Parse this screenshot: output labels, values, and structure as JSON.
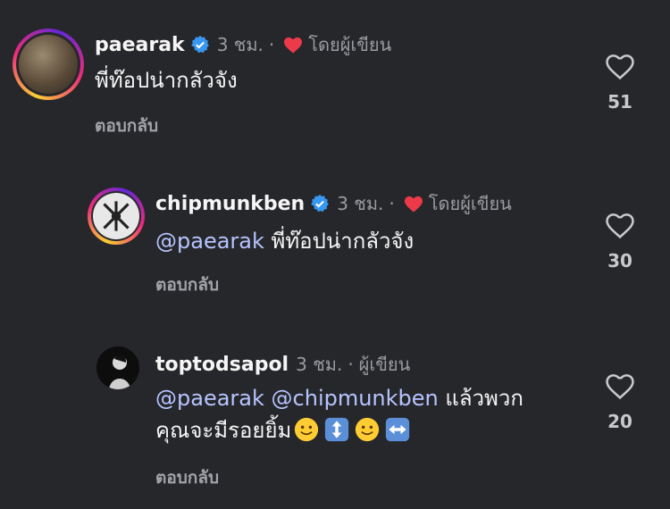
{
  "comments": [
    {
      "username": "paearak",
      "time": "3 ชม.",
      "author_badge": "โดยผู้เขียน",
      "text": "พี่ท๊อปน่ากลัวจัง",
      "reply": "ตอบกลับ",
      "likes": "51"
    },
    {
      "username": "chipmunkben",
      "time": "3 ชม.",
      "author_badge": "โดยผู้เขียน",
      "mention": "@paearak",
      "text": "พี่ท๊อปน่ากลัวจัง",
      "reply": "ตอบกลับ",
      "likes": "30"
    },
    {
      "username": "toptodsapol",
      "time": "3 ชม.",
      "separator": "·",
      "author_label": "ผู้เขียน",
      "mention1": "@paearak",
      "mention2": "@chipmunkben",
      "text_line1": "แล้วพวก",
      "text_line2": "คุณจะมีรอยยิ้ม",
      "reply": "ตอบกลับ",
      "likes": "20"
    }
  ],
  "colors": {
    "background": "#26272b",
    "verified": "#3897f0",
    "heart": "#ed3a4b",
    "mention": "#b7c4ff"
  },
  "icons": [
    "verified-badge-icon",
    "heart-filled-icon",
    "heart-outline-icon",
    "slightly-smiling-face-emoji",
    "up-down-arrow-emoji",
    "left-right-arrow-emoji"
  ]
}
